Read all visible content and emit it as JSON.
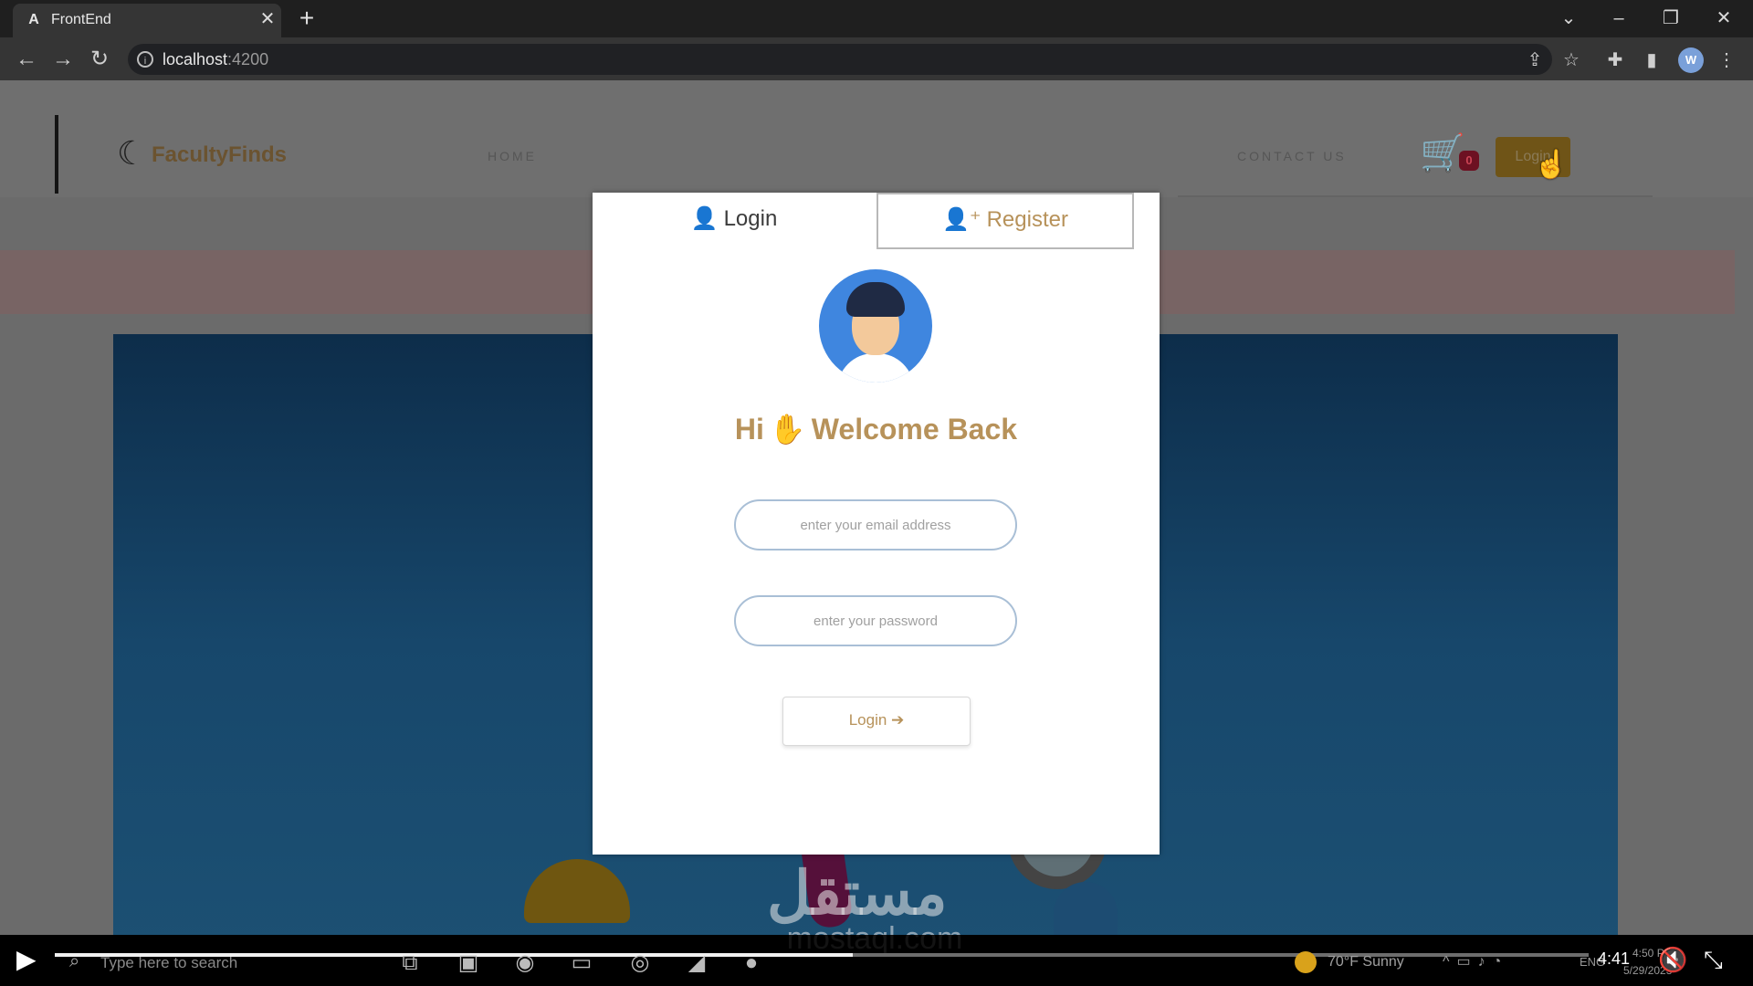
{
  "browser": {
    "tab_title": "FrontEnd",
    "tab_favicon": "A",
    "url_host": "localhost",
    "url_port": ":4200",
    "profile_initial": "W"
  },
  "site": {
    "brand": "FacultyFinds",
    "nav": {
      "home": "HOME",
      "contact": "CONTACT US",
      "cart_count": "0",
      "login": "Login"
    }
  },
  "modal": {
    "tabs": {
      "login": "Login",
      "register": "Register",
      "active": "login"
    },
    "greeting_hi": "Hi",
    "greeting_text": "Welcome Back",
    "email_placeholder": "enter your email address",
    "password_placeholder": "enter your password",
    "submit_label": "Login",
    "accent_color": "#b7925a"
  },
  "watermark": {
    "arabic": "مستقل",
    "latin": "mostaql.com"
  },
  "player": {
    "current_time": "4:41",
    "progress": 0.52
  },
  "taskbar": {
    "search_placeholder": "Type here to search",
    "weather": "70°F  Sunny",
    "language": "ENG",
    "clock_time": "4:50 PM",
    "clock_date": "5/29/2023"
  },
  "icons": {
    "cart": "cart-icon",
    "user": "user-icon",
    "user_plus": "user-plus-icon",
    "wave": "waving-hand-icon",
    "sign_in": "sign-in-icon"
  }
}
